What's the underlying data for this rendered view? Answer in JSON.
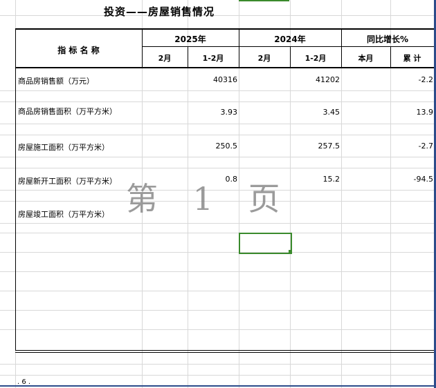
{
  "title": "投资——房屋销售情况",
  "header": {
    "indicator": "指 标 名 称",
    "year_2025": "2025年",
    "year_2024": "2024年",
    "yoy": "同比增长%",
    "feb_2025": "2月",
    "janfeb_2025": "1-2月",
    "feb_2024": "2月",
    "janfeb_2024": "1-2月",
    "this_month": "本月",
    "cumulative": "累 计"
  },
  "rows": [
    {
      "name": "商品房销售额（万元）",
      "janfeb_2025": "40316",
      "janfeb_2024": "41202",
      "cumulative": "-2.2"
    },
    {
      "name": "商品房销售面积（万平方米）",
      "janfeb_2025": "3.93",
      "janfeb_2024": "3.45",
      "cumulative": "13.9"
    },
    {
      "name": "房屋施工面积（万平方米）",
      "janfeb_2025": "250.5",
      "janfeb_2024": "257.5",
      "cumulative": "-2.7"
    },
    {
      "name": "房屋新开工面积（万平方米）",
      "janfeb_2025": "0.8",
      "janfeb_2024": "15.2",
      "cumulative": "-94.5"
    },
    {
      "name": "房屋竣工面积（万平方米）",
      "janfeb_2025": "",
      "janfeb_2024": "",
      "cumulative": ""
    }
  ],
  "watermark": "第 1 页",
  "footer": ". 6 ."
}
